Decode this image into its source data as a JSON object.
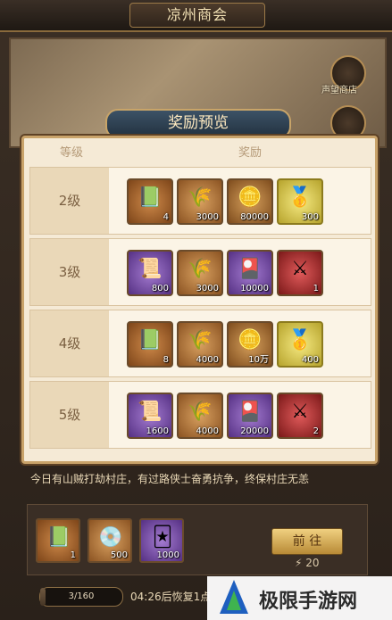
{
  "window": {
    "title": "凉州商会"
  },
  "map": {
    "shop_label": "声望商店"
  },
  "panel": {
    "title": "奖励预览",
    "col_level": "等级",
    "col_reward": "奖励",
    "rows": [
      {
        "level": "2级",
        "items": [
          {
            "icon": "green-book-icon",
            "color": "green",
            "qty": "4"
          },
          {
            "icon": "wheat-icon",
            "color": "orange",
            "qty": "3000"
          },
          {
            "icon": "coin-icon",
            "color": "gold",
            "qty": "80000"
          },
          {
            "icon": "gold-ingot-icon",
            "color": "yellow",
            "qty": "300"
          }
        ]
      },
      {
        "level": "3级",
        "items": [
          {
            "icon": "scroll-icon",
            "color": "purple",
            "qty": "800"
          },
          {
            "icon": "wheat-icon",
            "color": "orange",
            "qty": "3000"
          },
          {
            "icon": "jade-token-icon",
            "color": "purple",
            "qty": "10000"
          },
          {
            "icon": "war-token-icon",
            "color": "red",
            "qty": "1"
          }
        ]
      },
      {
        "level": "4级",
        "items": [
          {
            "icon": "green-book-icon",
            "color": "green",
            "qty": "8"
          },
          {
            "icon": "wheat-icon",
            "color": "orange",
            "qty": "4000"
          },
          {
            "icon": "coin-icon",
            "color": "gold",
            "qty": "10万"
          },
          {
            "icon": "gold-ingot-icon",
            "color": "yellow",
            "qty": "400"
          }
        ]
      },
      {
        "level": "5级",
        "items": [
          {
            "icon": "scroll-icon",
            "color": "purple",
            "qty": "1600"
          },
          {
            "icon": "wheat-icon",
            "color": "orange",
            "qty": "4000"
          },
          {
            "icon": "jade-token-icon",
            "color": "purple",
            "qty": "20000"
          },
          {
            "icon": "war-token-icon",
            "color": "red",
            "qty": "2"
          }
        ]
      }
    ]
  },
  "event": {
    "description": "今日有山贼打劫村庄，有过路侠士奋勇抗争，终保村庄无恙",
    "rewards": [
      {
        "icon": "green-book-icon",
        "color": "green",
        "qty": "1"
      },
      {
        "icon": "jade-disc-icon",
        "color": "orange",
        "qty": "500"
      },
      {
        "icon": "blue-card-icon",
        "color": "purple",
        "qty": "1000"
      }
    ],
    "go_label": "前 往",
    "cost": "20"
  },
  "stamina": {
    "value": "3/160",
    "fraction": 0.019,
    "restore_text": "04:26后恢复1点"
  },
  "watermark": {
    "text": "极限手游网"
  }
}
